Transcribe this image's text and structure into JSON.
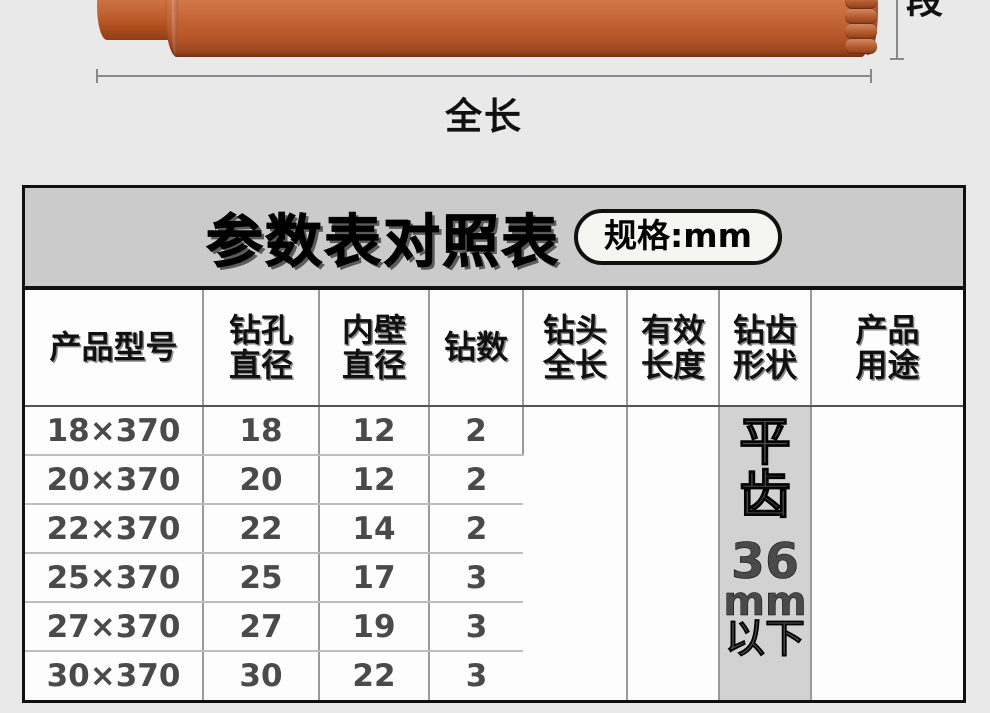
{
  "illustration": {
    "length_dimension_label": "全长",
    "diameter_dimension_label": "段",
    "product_color": "#c26334"
  },
  "table": {
    "title": "参数表对照表",
    "unit_badge": "规格:mm",
    "headers": [
      "产品型号",
      {
        "line1": "钻孔",
        "line2": "直径"
      },
      {
        "line1": "内壁",
        "line2": "直径"
      },
      "钻数",
      {
        "line1": "钻头",
        "line2": "全长"
      },
      {
        "line1": "有效",
        "line2": "长度"
      },
      {
        "line1": "钻齿",
        "line2": "形状"
      },
      {
        "line1": "产品",
        "line2": "用途"
      }
    ],
    "rows": [
      {
        "model": "18×370",
        "hole_diameter": "18",
        "inner_wall_diameter": "12",
        "drill_count": "2"
      },
      {
        "model": "20×370",
        "hole_diameter": "20",
        "inner_wall_diameter": "12",
        "drill_count": "2"
      },
      {
        "model": "22×370",
        "hole_diameter": "22",
        "inner_wall_diameter": "14",
        "drill_count": "2"
      },
      {
        "model": "25×370",
        "hole_diameter": "25",
        "inner_wall_diameter": "17",
        "drill_count": "3"
      },
      {
        "model": "27×370",
        "hole_diameter": "27",
        "inner_wall_diameter": "19",
        "drill_count": "3"
      },
      {
        "model": "30×370",
        "hole_diameter": "30",
        "inner_wall_diameter": "22",
        "drill_count": "3"
      }
    ],
    "merged": {
      "drill_total_length": "",
      "effective_length": "",
      "tooth_shape_main": "平齿",
      "tooth_shape_value": "36",
      "tooth_shape_unit": "mm",
      "tooth_shape_qualifier": "以下",
      "product_use": ""
    }
  }
}
